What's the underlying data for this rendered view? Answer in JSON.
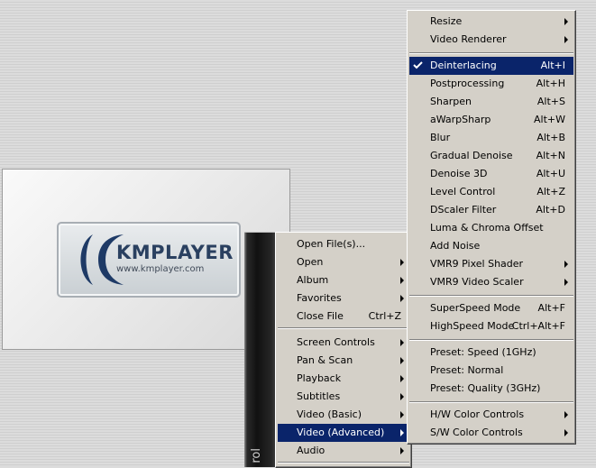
{
  "player": {
    "logo_text": "KMPLAYER",
    "logo_url": "www.kmplayer.com"
  },
  "control_strip": {
    "label": "rol"
  },
  "main_menu": {
    "items": [
      {
        "label": "Open File(s)...",
        "shortcut": "",
        "submenu": false
      },
      {
        "label": "Open",
        "shortcut": "",
        "submenu": true
      },
      {
        "label": "Album",
        "shortcut": "",
        "submenu": true
      },
      {
        "label": "Favorites",
        "shortcut": "",
        "submenu": true
      },
      {
        "label": "Close File",
        "shortcut": "Ctrl+Z",
        "submenu": false
      },
      {
        "label": "Screen Controls",
        "shortcut": "",
        "submenu": true
      },
      {
        "label": "Pan & Scan",
        "shortcut": "",
        "submenu": true
      },
      {
        "label": "Playback",
        "shortcut": "",
        "submenu": true
      },
      {
        "label": "Subtitles",
        "shortcut": "",
        "submenu": true
      },
      {
        "label": "Video (Basic)",
        "shortcut": "",
        "submenu": true
      },
      {
        "label": "Video (Advanced)",
        "shortcut": "",
        "submenu": true,
        "highlighted": true
      },
      {
        "label": "Audio",
        "shortcut": "",
        "submenu": true
      }
    ]
  },
  "sub_menu": {
    "items": [
      {
        "label": "Resize",
        "shortcut": "",
        "submenu": true
      },
      {
        "label": "Video Renderer",
        "shortcut": "",
        "submenu": true
      },
      {
        "label": "Deinterlacing",
        "shortcut": "Alt+I",
        "checked": true,
        "highlighted": true
      },
      {
        "label": "Postprocessing",
        "shortcut": "Alt+H"
      },
      {
        "label": "Sharpen",
        "shortcut": "Alt+S"
      },
      {
        "label": "aWarpSharp",
        "shortcut": "Alt+W"
      },
      {
        "label": "Blur",
        "shortcut": "Alt+B"
      },
      {
        "label": "Gradual Denoise",
        "shortcut": "Alt+N"
      },
      {
        "label": "Denoise 3D",
        "shortcut": "Alt+U"
      },
      {
        "label": "Level Control",
        "shortcut": "Alt+Z"
      },
      {
        "label": "DScaler Filter",
        "shortcut": "Alt+D"
      },
      {
        "label": "Luma & Chroma Offset",
        "shortcut": ""
      },
      {
        "label": "Add Noise",
        "shortcut": ""
      },
      {
        "label": "VMR9 Pixel Shader",
        "shortcut": "",
        "submenu": true
      },
      {
        "label": "VMR9 Video Scaler",
        "shortcut": "",
        "submenu": true
      },
      {
        "label": "SuperSpeed Mode",
        "shortcut": "Alt+F"
      },
      {
        "label": "HighSpeed Mode",
        "shortcut": "Ctrl+Alt+F"
      },
      {
        "label": "Preset: Speed (1GHz)",
        "shortcut": ""
      },
      {
        "label": "Preset: Normal",
        "shortcut": ""
      },
      {
        "label": "Preset: Quality (3GHz)",
        "shortcut": ""
      },
      {
        "label": "H/W Color Controls",
        "shortcut": "",
        "submenu": true
      },
      {
        "label": "S/W Color Controls",
        "shortcut": "",
        "submenu": true
      }
    ]
  },
  "colors": {
    "menu_bg": "#d4d0c8",
    "highlight": "#0a246a",
    "logo_blue": "#2a4060"
  }
}
